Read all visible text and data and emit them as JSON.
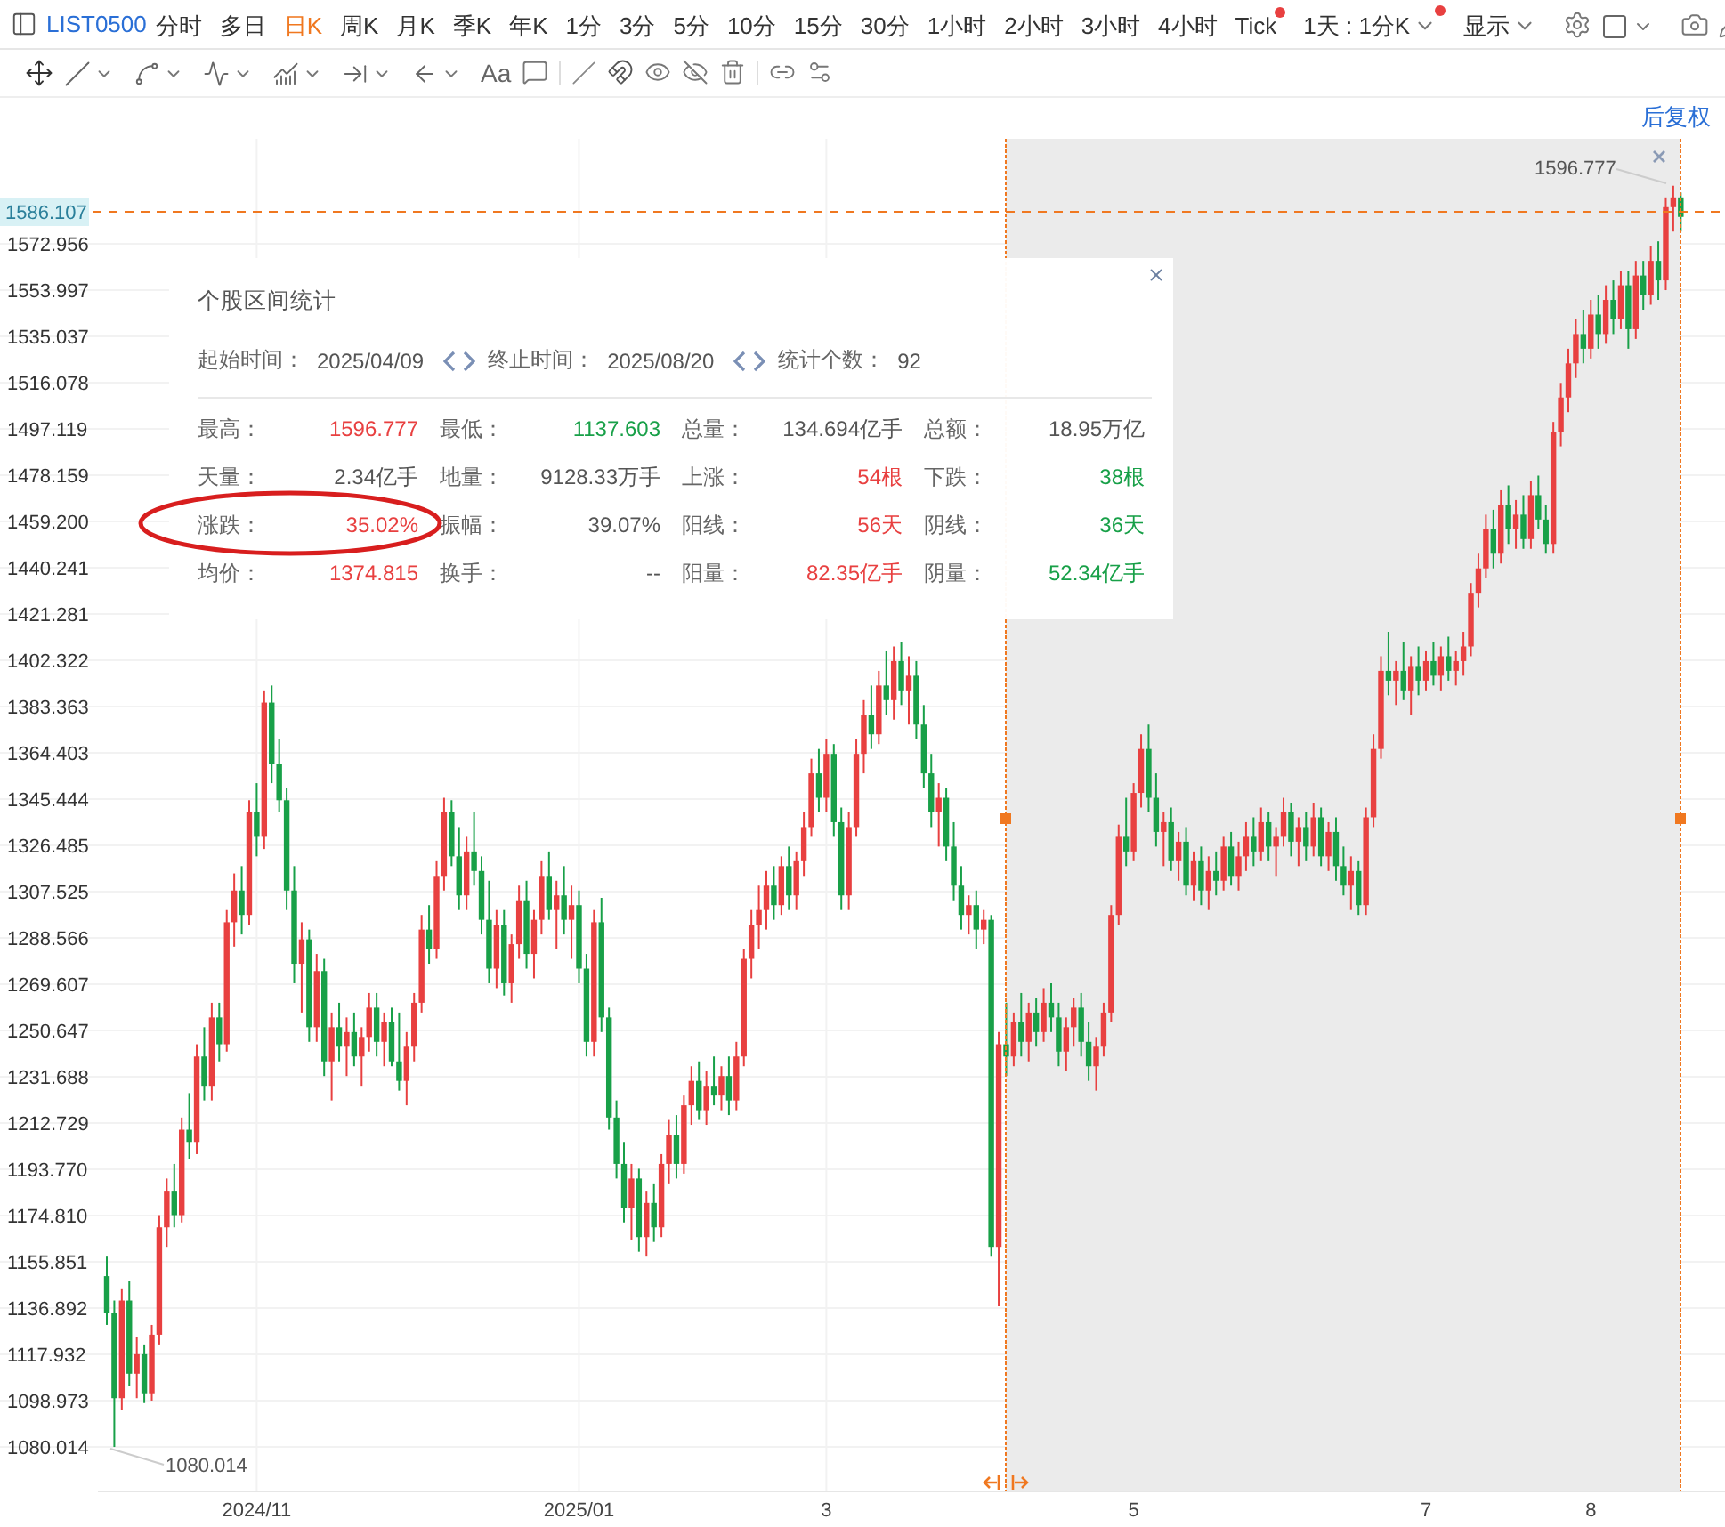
{
  "toolbar": {
    "symbol": "LIST0500",
    "periods": [
      {
        "label": "分时",
        "selected": false,
        "notify": false
      },
      {
        "label": "多日",
        "selected": false,
        "notify": false
      },
      {
        "label": "日K",
        "selected": true,
        "notify": false
      },
      {
        "label": "周K",
        "selected": false,
        "notify": false
      },
      {
        "label": "月K",
        "selected": false,
        "notify": false
      },
      {
        "label": "季K",
        "selected": false,
        "notify": false
      },
      {
        "label": "年K",
        "selected": false,
        "notify": false
      },
      {
        "label": "1分",
        "selected": false,
        "notify": false
      },
      {
        "label": "3分",
        "selected": false,
        "notify": false
      },
      {
        "label": "5分",
        "selected": false,
        "notify": false
      },
      {
        "label": "10分",
        "selected": false,
        "notify": false
      },
      {
        "label": "15分",
        "selected": false,
        "notify": false
      },
      {
        "label": "30分",
        "selected": false,
        "notify": false
      },
      {
        "label": "1小时",
        "selected": false,
        "notify": false
      },
      {
        "label": "2小时",
        "selected": false,
        "notify": false
      },
      {
        "label": "3小时",
        "selected": false,
        "notify": false
      },
      {
        "label": "4小时",
        "selected": false,
        "notify": false
      },
      {
        "label": "Tick",
        "selected": false,
        "notify": true
      }
    ],
    "interval": {
      "label": "1天 : 1分K",
      "notify": true
    },
    "display": "显示"
  },
  "drawing_tools": {
    "text_tool": "Aa"
  },
  "adjust": "后复权",
  "chart": {
    "high_marker": "1596.777",
    "low_marker": "1080.014",
    "chart_data": {
      "type": "candlestick",
      "grid": true,
      "ylim": [
        1061.8,
        1616.0
      ],
      "ref_lines": [
        {
          "axis": "y",
          "value": 1586.107,
          "label": "1586.107"
        }
      ],
      "categories": [
        null,
        null,
        null,
        null,
        null,
        null,
        null,
        null,
        null,
        null,
        null,
        null,
        null,
        null,
        null,
        null,
        null,
        null,
        null,
        null,
        "2024/11",
        null,
        null,
        null,
        null,
        null,
        null,
        null,
        null,
        null,
        null,
        null,
        null,
        null,
        null,
        null,
        null,
        null,
        null,
        null,
        null,
        null,
        null,
        null,
        null,
        null,
        null,
        null,
        null,
        null,
        null,
        null,
        null,
        null,
        null,
        null,
        null,
        null,
        null,
        null,
        null,
        null,
        null,
        "2025/01",
        null,
        null,
        null,
        null,
        null,
        null,
        null,
        null,
        null,
        null,
        null,
        null,
        null,
        null,
        null,
        null,
        null,
        null,
        null,
        null,
        null,
        null,
        null,
        null,
        null,
        null,
        null,
        null,
        null,
        null,
        null,
        null,
        "3",
        null,
        null,
        null,
        null,
        null,
        null,
        null,
        null,
        null,
        null,
        null,
        null,
        null,
        null,
        null,
        null,
        null,
        null,
        null,
        null,
        null,
        null,
        null,
        null,
        null,
        null,
        null,
        null,
        null,
        null,
        null,
        null,
        null,
        null,
        null,
        null,
        null,
        null,
        null,
        null,
        "5",
        null,
        null,
        null,
        null,
        null,
        null,
        null,
        null,
        null,
        null,
        null,
        null,
        null,
        null,
        null,
        null,
        null,
        null,
        null,
        null,
        null,
        null,
        null,
        null,
        null,
        null,
        null,
        null,
        null,
        null,
        null,
        null,
        null,
        null,
        null,
        null,
        null,
        null,
        "7",
        null,
        null,
        null,
        null,
        null,
        null,
        null,
        null,
        null,
        null,
        null,
        null,
        null,
        null,
        null,
        null,
        null,
        null,
        null,
        null,
        null,
        "8",
        null,
        null,
        null,
        null,
        null,
        null,
        null,
        null,
        null,
        null,
        null,
        null
      ],
      "yticks": [
        {
          "value": 1572.956,
          "label": "1572.956"
        },
        {
          "value": 1553.997,
          "label": "1553.997"
        },
        {
          "value": 1535.037,
          "label": "1535.037"
        },
        {
          "value": 1516.078,
          "label": "1516.078"
        },
        {
          "value": 1497.119,
          "label": "1497.119"
        },
        {
          "value": 1478.159,
          "label": "1478.159"
        },
        {
          "value": 1459.2,
          "label": "1459.200"
        },
        {
          "value": 1440.241,
          "label": "1440.241"
        },
        {
          "value": 1421.281,
          "label": "1421.281"
        },
        {
          "value": 1402.322,
          "label": "1402.322"
        },
        {
          "value": 1383.363,
          "label": "1383.363"
        },
        {
          "value": 1364.403,
          "label": "1364.403"
        },
        {
          "value": 1345.444,
          "label": "1345.444"
        },
        {
          "value": 1326.485,
          "label": "1326.485"
        },
        {
          "value": 1307.525,
          "label": "1307.525"
        },
        {
          "value": 1288.566,
          "label": "1288.566"
        },
        {
          "value": 1269.607,
          "label": "1269.607"
        },
        {
          "value": 1250.647,
          "label": "1250.647"
        },
        {
          "value": 1231.688,
          "label": "1231.688"
        },
        {
          "value": 1212.729,
          "label": "1212.729"
        },
        {
          "value": 1193.77,
          "label": "1193.770"
        },
        {
          "value": 1174.81,
          "label": "1174.810"
        },
        {
          "value": 1155.851,
          "label": "1155.851"
        },
        {
          "value": 1136.892,
          "label": "1136.892"
        },
        {
          "value": 1117.932,
          "label": "1117.932"
        },
        {
          "value": 1098.973,
          "label": "1098.973"
        },
        {
          "value": 1080.014,
          "label": "1080.014"
        }
      ],
      "ohlc": [
        [
          1150,
          1158,
          1130,
          1135
        ],
        [
          1135,
          1140,
          1080.014,
          1100
        ],
        [
          1100,
          1145,
          1095,
          1140
        ],
        [
          1140,
          1148,
          1105,
          1110
        ],
        [
          1110,
          1125,
          1100,
          1118
        ],
        [
          1118,
          1122,
          1098,
          1102
        ],
        [
          1102,
          1130,
          1099,
          1126
        ],
        [
          1126,
          1175,
          1122,
          1170
        ],
        [
          1170,
          1190,
          1162,
          1185
        ],
        [
          1185,
          1196,
          1170,
          1175
        ],
        [
          1175,
          1215,
          1172,
          1210
        ],
        [
          1210,
          1225,
          1198,
          1205
        ],
        [
          1205,
          1245,
          1200,
          1240
        ],
        [
          1240,
          1252,
          1222,
          1228
        ],
        [
          1228,
          1262,
          1222,
          1256
        ],
        [
          1256,
          1262,
          1238,
          1245
        ],
        [
          1245,
          1300,
          1242,
          1295
        ],
        [
          1295,
          1315,
          1285,
          1308
        ],
        [
          1308,
          1318,
          1290,
          1298
        ],
        [
          1298,
          1345,
          1294,
          1340
        ],
        [
          1340,
          1352,
          1322,
          1330
        ],
        [
          1330,
          1390,
          1325,
          1385
        ],
        [
          1385,
          1392,
          1352,
          1360
        ],
        [
          1360,
          1370,
          1340,
          1345
        ],
        [
          1345,
          1350,
          1300,
          1308
        ],
        [
          1308,
          1318,
          1270,
          1278
        ],
        [
          1278,
          1295,
          1258,
          1288
        ],
        [
          1288,
          1292,
          1246,
          1252
        ],
        [
          1252,
          1282,
          1246,
          1275
        ],
        [
          1275,
          1280,
          1232,
          1238
        ],
        [
          1238,
          1258,
          1222,
          1252
        ],
        [
          1252,
          1262,
          1238,
          1244
        ],
        [
          1244,
          1256,
          1232,
          1250
        ],
        [
          1250,
          1258,
          1236,
          1240
        ],
        [
          1240,
          1252,
          1228,
          1248
        ],
        [
          1248,
          1266,
          1242,
          1260
        ],
        [
          1260,
          1266,
          1240,
          1246
        ],
        [
          1246,
          1258,
          1236,
          1254
        ],
        [
          1254,
          1260,
          1236,
          1238
        ],
        [
          1238,
          1258,
          1226,
          1230
        ],
        [
          1230,
          1250,
          1220,
          1244
        ],
        [
          1244,
          1266,
          1238,
          1262
        ],
        [
          1262,
          1298,
          1258,
          1292
        ],
        [
          1292,
          1302,
          1278,
          1284
        ],
        [
          1284,
          1320,
          1280,
          1314
        ],
        [
          1314,
          1346,
          1308,
          1340
        ],
        [
          1340,
          1345,
          1318,
          1322
        ],
        [
          1322,
          1334,
          1300,
          1306
        ],
        [
          1306,
          1330,
          1300,
          1324
        ],
        [
          1324,
          1340,
          1310,
          1316
        ],
        [
          1316,
          1322,
          1290,
          1296
        ],
        [
          1296,
          1312,
          1270,
          1276
        ],
        [
          1276,
          1300,
          1268,
          1294
        ],
        [
          1294,
          1300,
          1265,
          1270
        ],
        [
          1270,
          1290,
          1262,
          1286
        ],
        [
          1286,
          1310,
          1280,
          1304
        ],
        [
          1304,
          1312,
          1276,
          1282
        ],
        [
          1282,
          1300,
          1272,
          1296
        ],
        [
          1296,
          1320,
          1290,
          1314
        ],
        [
          1314,
          1324,
          1296,
          1300
        ],
        [
          1300,
          1312,
          1284,
          1306
        ],
        [
          1306,
          1318,
          1290,
          1296
        ],
        [
          1296,
          1310,
          1280,
          1302
        ],
        [
          1302,
          1308,
          1270,
          1276
        ],
        [
          1276,
          1282,
          1240,
          1246
        ],
        [
          1246,
          1300,
          1240,
          1295
        ],
        [
          1295,
          1305,
          1250,
          1256
        ],
        [
          1256,
          1260,
          1210,
          1215
        ],
        [
          1215,
          1222,
          1190,
          1196
        ],
        [
          1196,
          1205,
          1172,
          1178
        ],
        [
          1178,
          1196,
          1165,
          1190
        ],
        [
          1190,
          1194,
          1160,
          1166
        ],
        [
          1166,
          1185,
          1158,
          1180
        ],
        [
          1180,
          1188,
          1164,
          1170
        ],
        [
          1170,
          1200,
          1166,
          1196
        ],
        [
          1196,
          1214,
          1188,
          1208
        ],
        [
          1208,
          1216,
          1190,
          1196
        ],
        [
          1196,
          1224,
          1192,
          1220
        ],
        [
          1220,
          1236,
          1212,
          1230
        ],
        [
          1230,
          1238,
          1214,
          1218
        ],
        [
          1218,
          1234,
          1212,
          1228
        ],
        [
          1228,
          1240,
          1220,
          1224
        ],
        [
          1224,
          1236,
          1218,
          1232
        ],
        [
          1232,
          1240,
          1216,
          1222
        ],
        [
          1222,
          1246,
          1218,
          1240
        ],
        [
          1240,
          1284,
          1236,
          1280
        ],
        [
          1280,
          1300,
          1272,
          1294
        ],
        [
          1294,
          1310,
          1284,
          1300
        ],
        [
          1300,
          1316,
          1292,
          1310
        ],
        [
          1310,
          1318,
          1296,
          1302
        ],
        [
          1302,
          1322,
          1298,
          1318
        ],
        [
          1318,
          1326,
          1300,
          1306
        ],
        [
          1306,
          1324,
          1300,
          1320
        ],
        [
          1320,
          1340,
          1314,
          1334
        ],
        [
          1334,
          1362,
          1330,
          1356
        ],
        [
          1356,
          1366,
          1340,
          1346
        ],
        [
          1346,
          1370,
          1340,
          1364
        ],
        [
          1364,
          1368,
          1330,
          1336
        ],
        [
          1336,
          1342,
          1300,
          1306
        ],
        [
          1306,
          1340,
          1300,
          1334
        ],
        [
          1334,
          1370,
          1330,
          1364
        ],
        [
          1364,
          1386,
          1356,
          1380
        ],
        [
          1380,
          1392,
          1366,
          1372
        ],
        [
          1372,
          1398,
          1368,
          1392
        ],
        [
          1392,
          1406,
          1380,
          1386
        ],
        [
          1386,
          1408,
          1378,
          1402
        ],
        [
          1402,
          1410,
          1384,
          1390
        ],
        [
          1390,
          1404,
          1376,
          1396
        ],
        [
          1396,
          1402,
          1370,
          1376
        ],
        [
          1376,
          1384,
          1350,
          1356
        ],
        [
          1356,
          1364,
          1334,
          1340
        ],
        [
          1340,
          1352,
          1326,
          1346
        ],
        [
          1346,
          1350,
          1320,
          1326
        ],
        [
          1326,
          1336,
          1304,
          1310
        ],
        [
          1310,
          1318,
          1292,
          1298
        ],
        [
          1298,
          1306,
          1290,
          1302
        ],
        [
          1302,
          1308,
          1284,
          1292
        ],
        [
          1292,
          1300,
          1286,
          1296
        ],
        [
          1296,
          1298,
          1158,
          1162
        ],
        [
          1162,
          1250,
          1137.603,
          1245
        ],
        [
          1245,
          1262,
          1232,
          1240
        ],
        [
          1240,
          1258,
          1236,
          1254
        ],
        [
          1254,
          1266,
          1240,
          1246
        ],
        [
          1246,
          1262,
          1238,
          1258
        ],
        [
          1258,
          1264,
          1244,
          1250
        ],
        [
          1250,
          1268,
          1246,
          1262
        ],
        [
          1262,
          1270,
          1250,
          1256
        ],
        [
          1256,
          1262,
          1236,
          1242
        ],
        [
          1242,
          1256,
          1234,
          1252
        ],
        [
          1252,
          1264,
          1244,
          1260
        ],
        [
          1260,
          1266,
          1240,
          1246
        ],
        [
          1246,
          1254,
          1230,
          1236
        ],
        [
          1236,
          1248,
          1226,
          1244
        ],
        [
          1244,
          1262,
          1240,
          1258
        ],
        [
          1258,
          1302,
          1254,
          1298
        ],
        [
          1298,
          1335,
          1294,
          1330
        ],
        [
          1330,
          1346,
          1318,
          1324
        ],
        [
          1324,
          1352,
          1320,
          1348
        ],
        [
          1348,
          1372,
          1342,
          1366
        ],
        [
          1366,
          1376,
          1340,
          1346
        ],
        [
          1346,
          1356,
          1326,
          1332
        ],
        [
          1332,
          1340,
          1318,
          1336
        ],
        [
          1336,
          1342,
          1316,
          1320
        ],
        [
          1320,
          1332,
          1312,
          1328
        ],
        [
          1328,
          1334,
          1306,
          1310
        ],
        [
          1310,
          1324,
          1304,
          1320
        ],
        [
          1320,
          1326,
          1302,
          1308
        ],
        [
          1308,
          1322,
          1300,
          1316
        ],
        [
          1316,
          1324,
          1306,
          1312
        ],
        [
          1312,
          1330,
          1308,
          1326
        ],
        [
          1326,
          1332,
          1310,
          1314
        ],
        [
          1314,
          1328,
          1308,
          1322
        ],
        [
          1322,
          1336,
          1316,
          1330
        ],
        [
          1330,
          1338,
          1318,
          1324
        ],
        [
          1324,
          1342,
          1320,
          1336
        ],
        [
          1336,
          1340,
          1320,
          1326
        ],
        [
          1326,
          1334,
          1314,
          1330
        ],
        [
          1330,
          1346,
          1326,
          1340
        ],
        [
          1340,
          1344,
          1322,
          1328
        ],
        [
          1328,
          1338,
          1318,
          1334
        ],
        [
          1334,
          1340,
          1320,
          1326
        ],
        [
          1326,
          1344,
          1322,
          1338
        ],
        [
          1338,
          1342,
          1318,
          1322
        ],
        [
          1322,
          1336,
          1316,
          1332
        ],
        [
          1332,
          1338,
          1312,
          1318
        ],
        [
          1318,
          1326,
          1306,
          1310
        ],
        [
          1310,
          1322,
          1300,
          1316
        ],
        [
          1316,
          1320,
          1298,
          1302
        ],
        [
          1302,
          1342,
          1298,
          1338
        ],
        [
          1338,
          1372,
          1334,
          1366
        ],
        [
          1366,
          1404,
          1362,
          1398
        ],
        [
          1398,
          1414,
          1388,
          1394
        ],
        [
          1394,
          1402,
          1384,
          1398
        ],
        [
          1398,
          1410,
          1386,
          1390
        ],
        [
          1390,
          1404,
          1380,
          1400
        ],
        [
          1400,
          1408,
          1388,
          1394
        ],
        [
          1394,
          1406,
          1390,
          1402
        ],
        [
          1402,
          1410,
          1392,
          1396
        ],
        [
          1396,
          1408,
          1390,
          1404
        ],
        [
          1404,
          1412,
          1394,
          1398
        ],
        [
          1398,
          1406,
          1392,
          1402
        ],
        [
          1402,
          1414,
          1396,
          1408
        ],
        [
          1408,
          1434,
          1404,
          1430
        ],
        [
          1430,
          1446,
          1424,
          1440
        ],
        [
          1440,
          1462,
          1436,
          1456
        ],
        [
          1456,
          1464,
          1440,
          1446
        ],
        [
          1446,
          1472,
          1442,
          1466
        ],
        [
          1466,
          1474,
          1450,
          1456
        ],
        [
          1456,
          1468,
          1448,
          1462
        ],
        [
          1462,
          1470,
          1448,
          1452
        ],
        [
          1452,
          1476,
          1448,
          1470
        ],
        [
          1470,
          1478,
          1456,
          1460
        ],
        [
          1460,
          1466,
          1446,
          1450
        ],
        [
          1450,
          1500,
          1446,
          1496
        ],
        [
          1496,
          1516,
          1490,
          1510
        ],
        [
          1510,
          1530,
          1504,
          1524
        ],
        [
          1524,
          1542,
          1518,
          1536
        ],
        [
          1536,
          1546,
          1524,
          1530
        ],
        [
          1530,
          1550,
          1526,
          1544
        ],
        [
          1544,
          1552,
          1530,
          1536
        ],
        [
          1536,
          1556,
          1532,
          1550
        ],
        [
          1550,
          1558,
          1536,
          1542
        ],
        [
          1542,
          1562,
          1538,
          1556
        ],
        [
          1556,
          1562,
          1530,
          1538
        ],
        [
          1538,
          1566,
          1534,
          1560
        ],
        [
          1560,
          1566,
          1546,
          1552
        ],
        [
          1552,
          1572,
          1548,
          1566
        ],
        [
          1566,
          1574,
          1550,
          1558
        ],
        [
          1558,
          1592,
          1554,
          1588
        ],
        [
          1588,
          1596.777,
          1578,
          1592
        ],
        [
          1592,
          1594,
          1578,
          1584
        ]
      ]
    }
  },
  "stats_panel": {
    "title": "个股区间统计",
    "start_label": "起始时间：",
    "start": "2025/04/09",
    "end_label": "终止时间：",
    "end": "2025/08/20",
    "count_label": "统计个数：",
    "count": "92",
    "cells": [
      {
        "label": "最高：",
        "value": "1596.777",
        "color": "#e84040"
      },
      {
        "label": "最低：",
        "value": "1137.603",
        "color": "#18a048"
      },
      {
        "label": "总量：",
        "value": "134.694亿手",
        "color": "#555555"
      },
      {
        "label": "总额：",
        "value": "18.95万亿",
        "color": "#555555"
      },
      {
        "label": "天量：",
        "value": "2.34亿手",
        "color": "#555555"
      },
      {
        "label": "地量：",
        "value": "9128.33万手",
        "color": "#555555"
      },
      {
        "label": "上涨：",
        "value": "54根",
        "color": "#e84040"
      },
      {
        "label": "下跌：",
        "value": "38根",
        "color": "#18a048"
      },
      {
        "label": "涨跌：",
        "value": "35.02%",
        "color": "#e84040"
      },
      {
        "label": "振幅：",
        "value": "39.07%",
        "color": "#555555"
      },
      {
        "label": "阳线：",
        "value": "56天",
        "color": "#e84040"
      },
      {
        "label": "阴线：",
        "value": "36天",
        "color": "#18a048"
      },
      {
        "label": "均价：",
        "value": "1374.815",
        "color": "#e84040"
      },
      {
        "label": "换手：",
        "value": "--",
        "color": "#555555"
      },
      {
        "label": "阳量：",
        "value": "82.35亿手",
        "color": "#e84040"
      },
      {
        "label": "阴量：",
        "value": "52.34亿手",
        "color": "#18a048"
      }
    ]
  }
}
